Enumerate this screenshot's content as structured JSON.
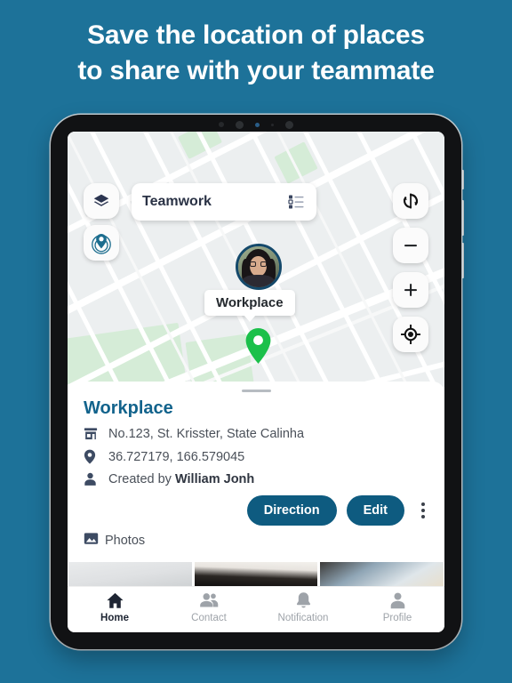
{
  "headline": {
    "line1": "Save the location of places",
    "line2": "to share with your teammate"
  },
  "colors": {
    "background": "#1d7299",
    "accent": "#0e5b80",
    "title": "#12638c",
    "marker_green": "#1bc04a",
    "icon_navy": "#3d4b63",
    "nav_active": "#1e2533",
    "nav_inactive": "#9ea3a9"
  },
  "map": {
    "search_bar": {
      "title": "Teamwork",
      "layers_icon": "layers-icon",
      "list_icon": "list-icon"
    },
    "controls": {
      "refresh": "refresh-icon",
      "zoom_out": "−",
      "zoom_in": "+",
      "locate": "my-location-icon",
      "my_place": "place-pin-rings-icon"
    },
    "marker": {
      "avatar": "user-avatar",
      "callout_label": "Workplace",
      "pin": "green-location-pin"
    }
  },
  "card": {
    "grabber": "drag-handle",
    "title": "Workplace",
    "rows": [
      {
        "icon": "store-icon",
        "text": "No.123, St. Krisster, State Calinha"
      },
      {
        "icon": "pin-icon",
        "text": "36.727179, 166.579045"
      },
      {
        "icon": "person-icon",
        "prefix": "Created by ",
        "author": "William Jonh"
      }
    ],
    "buttons": {
      "direction": "Direction",
      "edit": "Edit",
      "more": "more-options-icon"
    },
    "photos": {
      "icon": "photo-icon",
      "label": "Photos",
      "thumbnails": [
        "photo-1",
        "photo-2",
        "photo-3"
      ]
    }
  },
  "bottom_nav": [
    {
      "label": "Home",
      "icon": "home-icon",
      "active": true
    },
    {
      "label": "Contact",
      "icon": "contacts-icon",
      "active": false
    },
    {
      "label": "Notification",
      "icon": "bell-icon",
      "active": false
    },
    {
      "label": "Profile",
      "icon": "person-icon",
      "active": false
    }
  ]
}
